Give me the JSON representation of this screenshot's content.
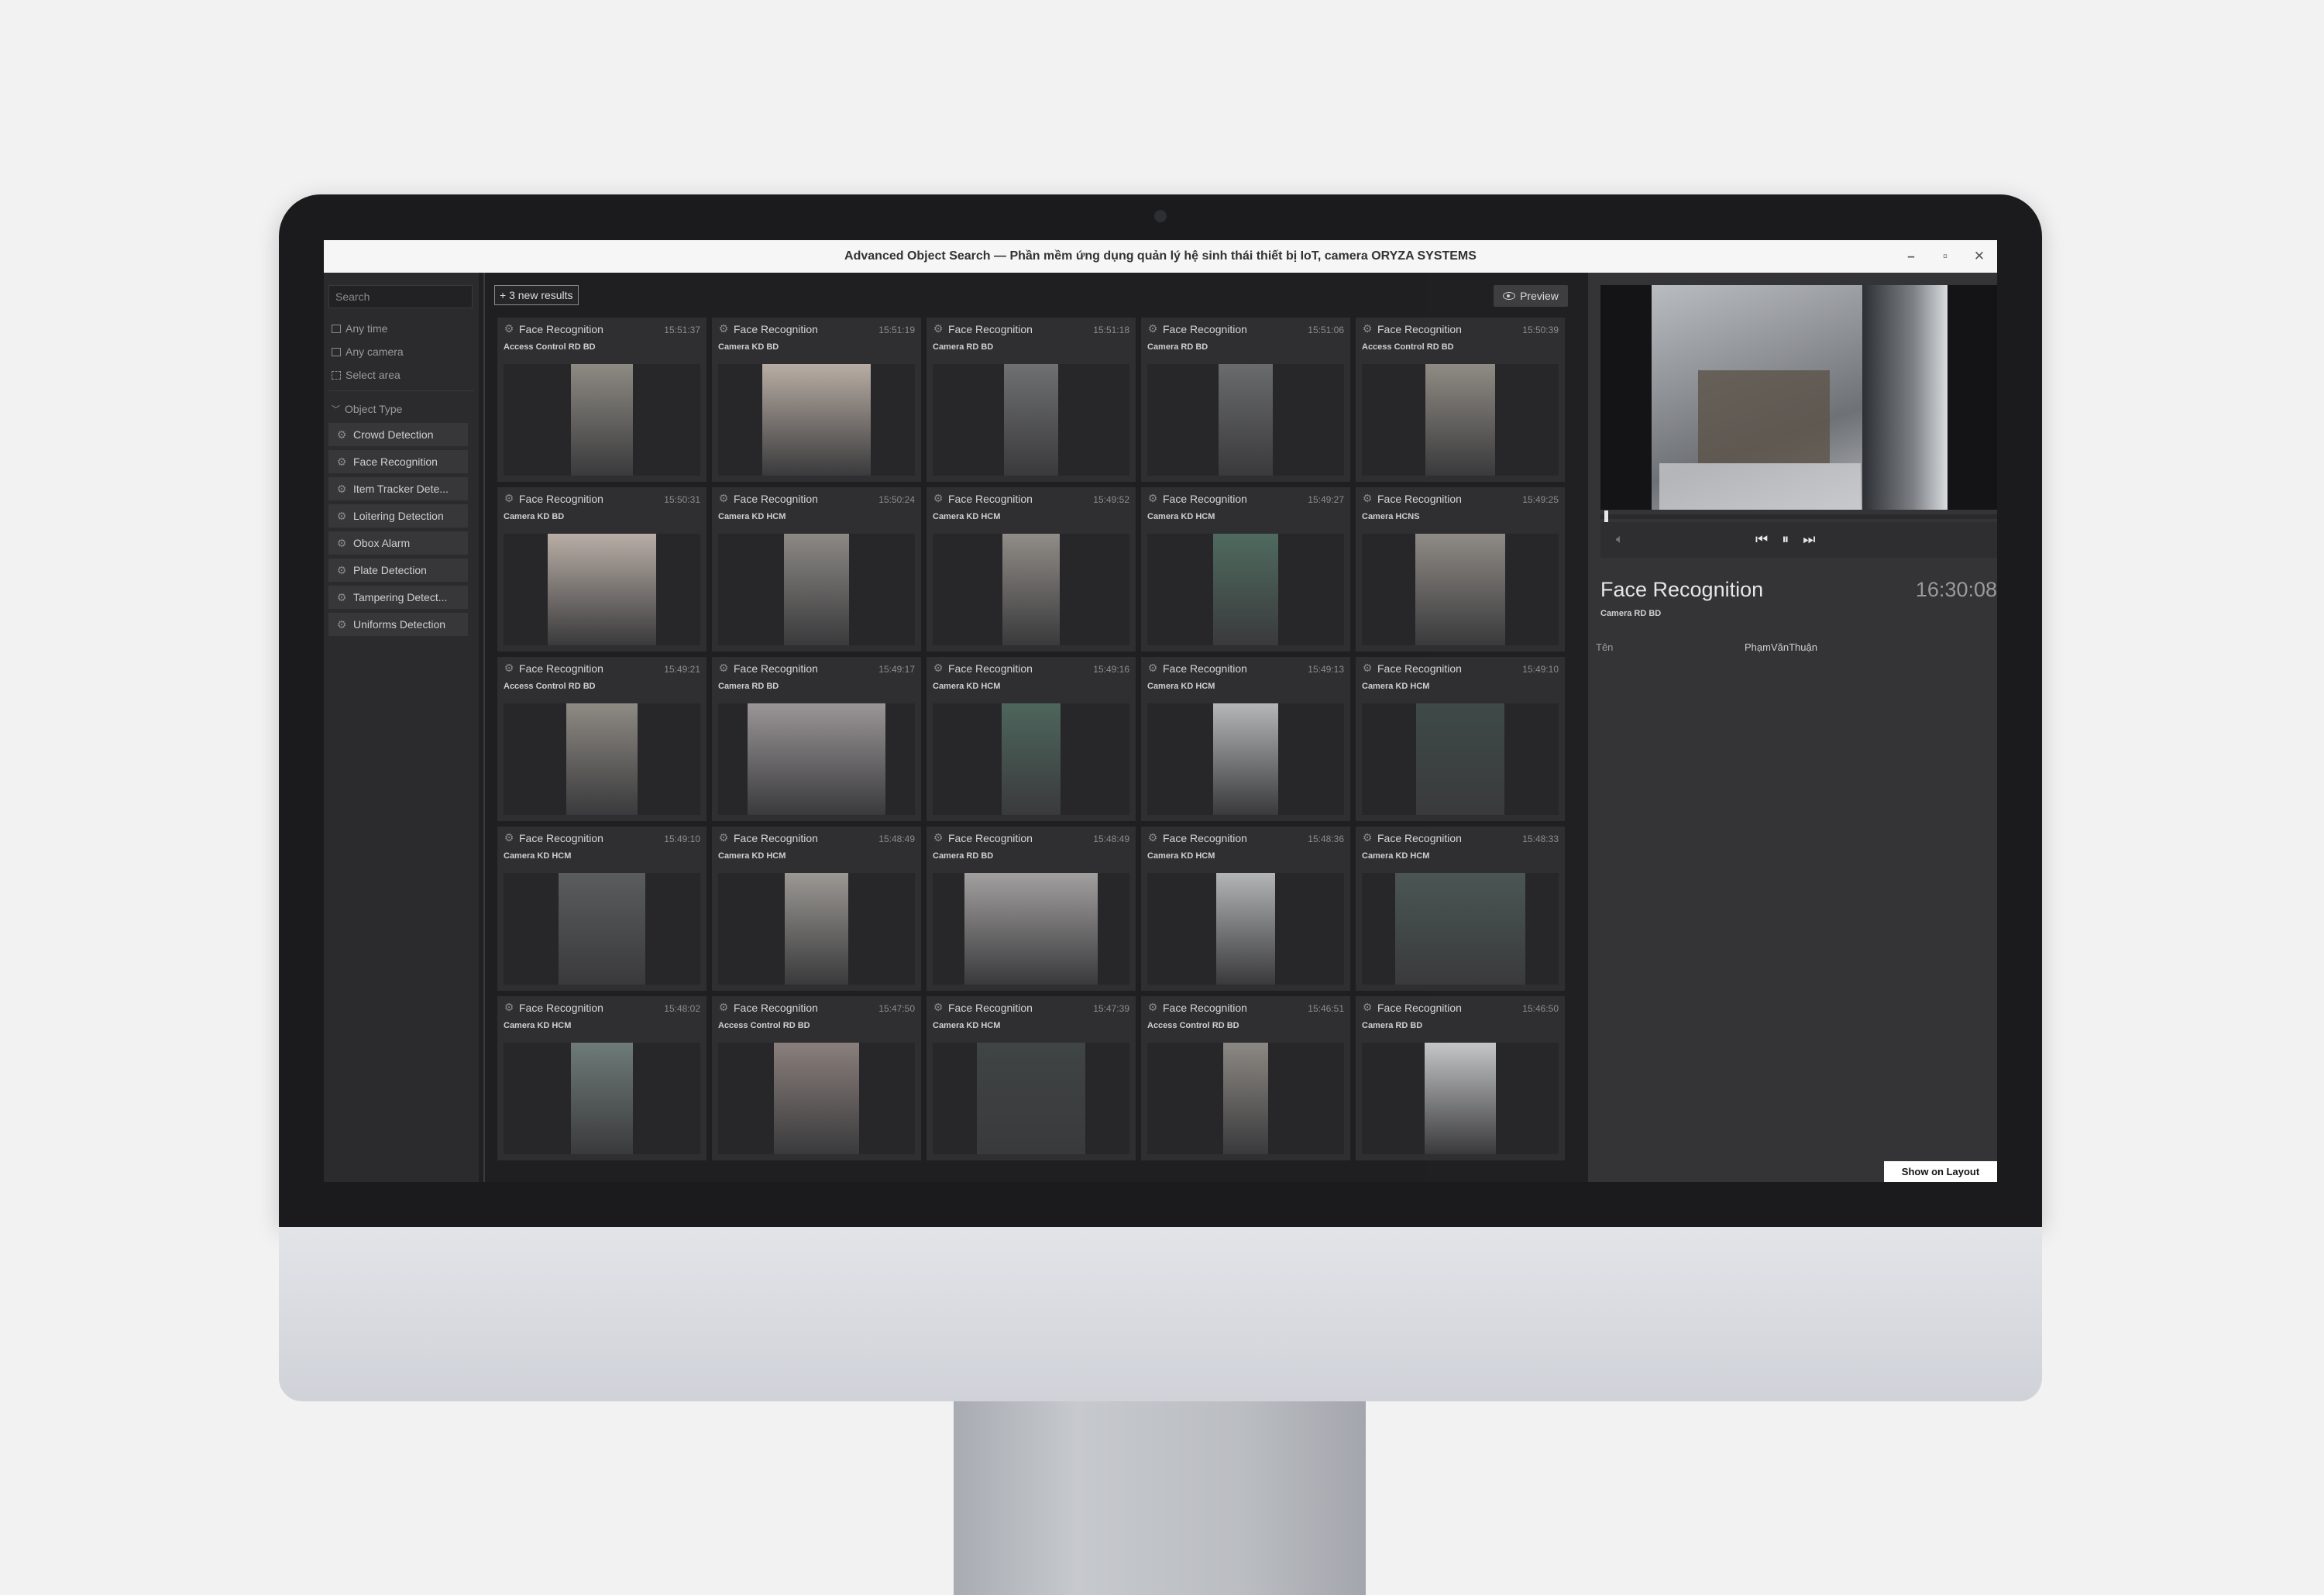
{
  "window": {
    "title": "Advanced Object Search — Phần mềm ứng dụng quản lý hệ sinh thái thiết bị IoT, camera ORYZA SYSTEMS",
    "minimize": "–",
    "maximize": "▫",
    "close": "✕"
  },
  "sidebar": {
    "search_placeholder": "Search",
    "filters": {
      "time": "Any time",
      "camera": "Any camera",
      "area": "Select area"
    },
    "object_type_label": "Object Type",
    "object_types": [
      "Crowd Detection",
      "Face Recognition",
      "Item Tracker Dete...",
      "Loitering Detection",
      "Obox Alarm",
      "Plate Detection",
      "Tampering Detect...",
      "Uniforms Detection"
    ]
  },
  "toolbar": {
    "new_results": "+ 3 new results",
    "preview": "Preview"
  },
  "results": [
    {
      "type": "Face Recognition",
      "time": "15:51:37",
      "camera": "Access Control RD BD",
      "thumb_color": "#8d8a83"
    },
    {
      "type": "Face Recognition",
      "time": "15:51:19",
      "camera": "Camera KD BD",
      "thumb_color": "#b8ada4"
    },
    {
      "type": "Face Recognition",
      "time": "15:51:18",
      "camera": "Camera RD BD",
      "thumb_color": "#6f7072"
    },
    {
      "type": "Face Recognition",
      "time": "15:51:06",
      "camera": "Camera RD BD",
      "thumb_color": "#6a6b6d"
    },
    {
      "type": "Face Recognition",
      "time": "15:50:39",
      "camera": "Access Control RD BD",
      "thumb_color": "#8f8b84"
    },
    {
      "type": "Face Recognition",
      "time": "15:50:31",
      "camera": "Camera KD BD",
      "thumb_color": "#b9aea6"
    },
    {
      "type": "Face Recognition",
      "time": "15:50:24",
      "camera": "Camera KD HCM",
      "thumb_color": "#8c8985"
    },
    {
      "type": "Face Recognition",
      "time": "15:49:52",
      "camera": "Camera KD HCM",
      "thumb_color": "#908c87"
    },
    {
      "type": "Face Recognition",
      "time": "15:49:27",
      "camera": "Camera KD HCM",
      "thumb_color": "#4f6a5f"
    },
    {
      "type": "Face Recognition",
      "time": "15:49:25",
      "camera": "Camera HCNS",
      "thumb_color": "#8f8a85"
    },
    {
      "type": "Face Recognition",
      "time": "15:49:21",
      "camera": "Access Control RD BD",
      "thumb_color": "#8e8a84"
    },
    {
      "type": "Face Recognition",
      "time": "15:49:17",
      "camera": "Camera RD BD",
      "thumb_color": "#9a9697"
    },
    {
      "type": "Face Recognition",
      "time": "15:49:16",
      "camera": "Camera KD HCM",
      "thumb_color": "#4d665c"
    },
    {
      "type": "Face Recognition",
      "time": "15:49:13",
      "camera": "Camera KD HCM",
      "thumb_color": "#b4b6b8"
    },
    {
      "type": "Face Recognition",
      "time": "15:49:10",
      "camera": "Camera KD HCM",
      "thumb_color": "#3e4a48"
    },
    {
      "type": "Face Recognition",
      "time": "15:49:10",
      "camera": "Camera KD HCM",
      "thumb_color": "#5a5c5e"
    },
    {
      "type": "Face Recognition",
      "time": "15:48:49",
      "camera": "Camera KD HCM",
      "thumb_color": "#9b9893"
    },
    {
      "type": "Face Recognition",
      "time": "15:48:49",
      "camera": "Camera RD BD",
      "thumb_color": "#a29f9f"
    },
    {
      "type": "Face Recognition",
      "time": "15:48:36",
      "camera": "Camera KD HCM",
      "thumb_color": "#b2b4b6"
    },
    {
      "type": "Face Recognition",
      "time": "15:48:33",
      "camera": "Camera KD HCM",
      "thumb_color": "#4a5654"
    },
    {
      "type": "Face Recognition",
      "time": "15:48:02",
      "camera": "Camera KD HCM",
      "thumb_color": "#6e7b78"
    },
    {
      "type": "Face Recognition",
      "time": "15:47:50",
      "camera": "Access Control RD BD",
      "thumb_color": "#8a7f7c"
    },
    {
      "type": "Face Recognition",
      "time": "15:47:39",
      "camera": "Camera KD HCM",
      "thumb_color": "#3f4444"
    },
    {
      "type": "Face Recognition",
      "time": "15:46:51",
      "camera": "Access Control RD BD",
      "thumb_color": "#8c8883"
    },
    {
      "type": "Face Recognition",
      "time": "15:46:50",
      "camera": "Camera RD BD",
      "thumb_color": "#c5c6c7"
    }
  ],
  "preview": {
    "title": "Face Recognition",
    "time": "16:30:08",
    "camera": "Camera RD BD",
    "attribute_label": "Tên",
    "attribute_value": "PhạmVănThuận",
    "show_on_layout": "Show on Layout",
    "video_progress": 0.01
  }
}
